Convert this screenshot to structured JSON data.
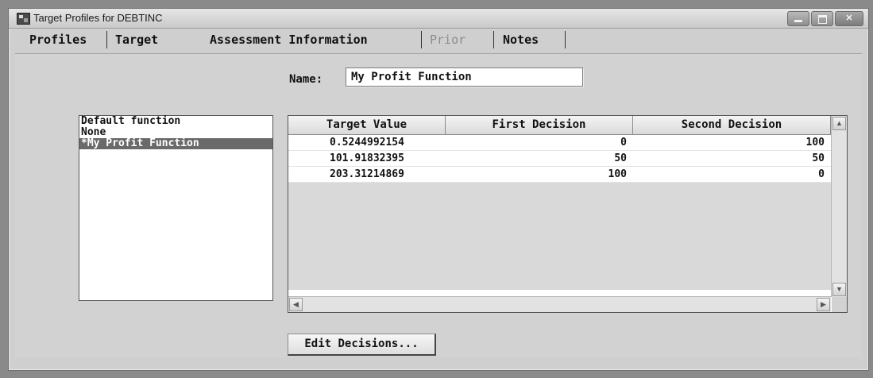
{
  "window": {
    "title": "Target Profiles for DEBTINC",
    "icon": "sas-app-icon",
    "controls": [
      "minimize-icon",
      "maximize-icon",
      "close-icon"
    ]
  },
  "tabs": [
    {
      "label": "Profiles",
      "active": false,
      "enabled": true
    },
    {
      "label": "Target",
      "active": false,
      "enabled": true
    },
    {
      "label": "Assessment Information",
      "active": true,
      "enabled": true
    },
    {
      "label": "Prior",
      "active": false,
      "enabled": false
    },
    {
      "label": "Notes",
      "active": false,
      "enabled": true
    }
  ],
  "name_field": {
    "label": "Name:",
    "value": "My Profit Function"
  },
  "function_list": {
    "items": [
      "Default function",
      "None",
      "*My Profit Function"
    ],
    "selected_index": 2
  },
  "grid": {
    "columns": [
      "Target Value",
      "First Decision",
      "Second Decision"
    ],
    "rows": [
      [
        "0.5244992154",
        "0",
        "100"
      ],
      [
        "101.91832395",
        "50",
        "50"
      ],
      [
        "203.31214869",
        "100",
        "0"
      ]
    ]
  },
  "edit_button_label": "Edit Decisions...",
  "colors": {
    "background": "#cfcfcf",
    "selection": "#6a6a6a",
    "disabled_tab": "#8c8c8c"
  }
}
